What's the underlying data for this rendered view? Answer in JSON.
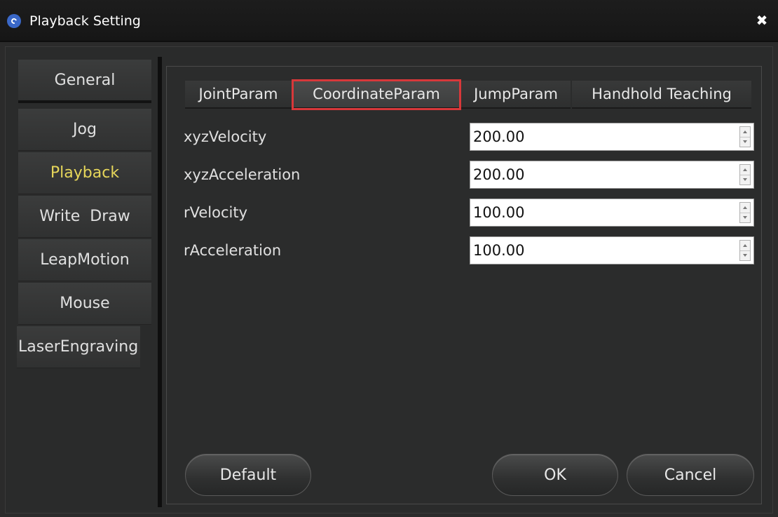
{
  "window": {
    "title": "Playback Setting",
    "icons": {
      "app": "app-logo-icon",
      "close": "close-icon"
    },
    "close_glyph": "✖"
  },
  "sidebar": {
    "items": [
      {
        "label": "General",
        "active": false
      },
      {
        "label": "Jog",
        "active": false
      },
      {
        "label": "Playback",
        "active": true
      },
      {
        "label": "Write  Draw",
        "active": false
      },
      {
        "label": "LeapMotion",
        "active": false
      },
      {
        "label": "Mouse",
        "active": false
      },
      {
        "label": "LaserEngraving",
        "active": false
      }
    ]
  },
  "tabs": [
    {
      "label": "JointParam",
      "active": false
    },
    {
      "label": "CoordinateParam",
      "active": true
    },
    {
      "label": "JumpParam",
      "active": false
    },
    {
      "label": "Handhold Teaching",
      "active": false
    }
  ],
  "params": [
    {
      "label": "xyzVelocity",
      "value": "200.00"
    },
    {
      "label": "xyzAcceleration",
      "value": "200.00"
    },
    {
      "label": "rVelocity",
      "value": "100.00"
    },
    {
      "label": "rAcceleration",
      "value": "100.00"
    }
  ],
  "buttons": {
    "default_label": "Default",
    "ok_label": "OK",
    "cancel_label": "Cancel"
  },
  "colors": {
    "active_sidebar_text": "#e6d65a",
    "active_tab_outline": "#d8383a",
    "app_icon": "#3a68c8"
  }
}
